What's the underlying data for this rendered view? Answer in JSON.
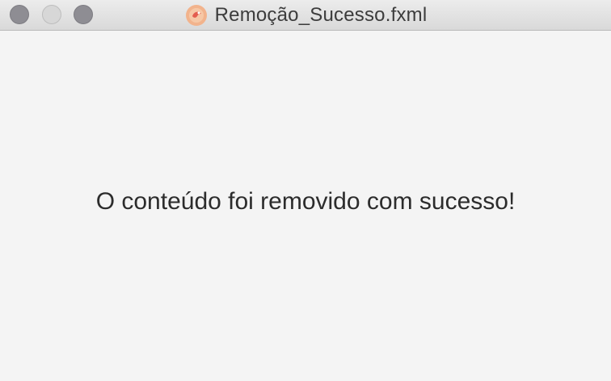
{
  "window": {
    "title": "Remoção_Sucesso.fxml",
    "app_icon": "java-duke-icon"
  },
  "traffic_lights": [
    "close-button",
    "minimize-button",
    "zoom-button"
  ],
  "content": {
    "message": "O conteúdo foi removido com sucesso!"
  }
}
